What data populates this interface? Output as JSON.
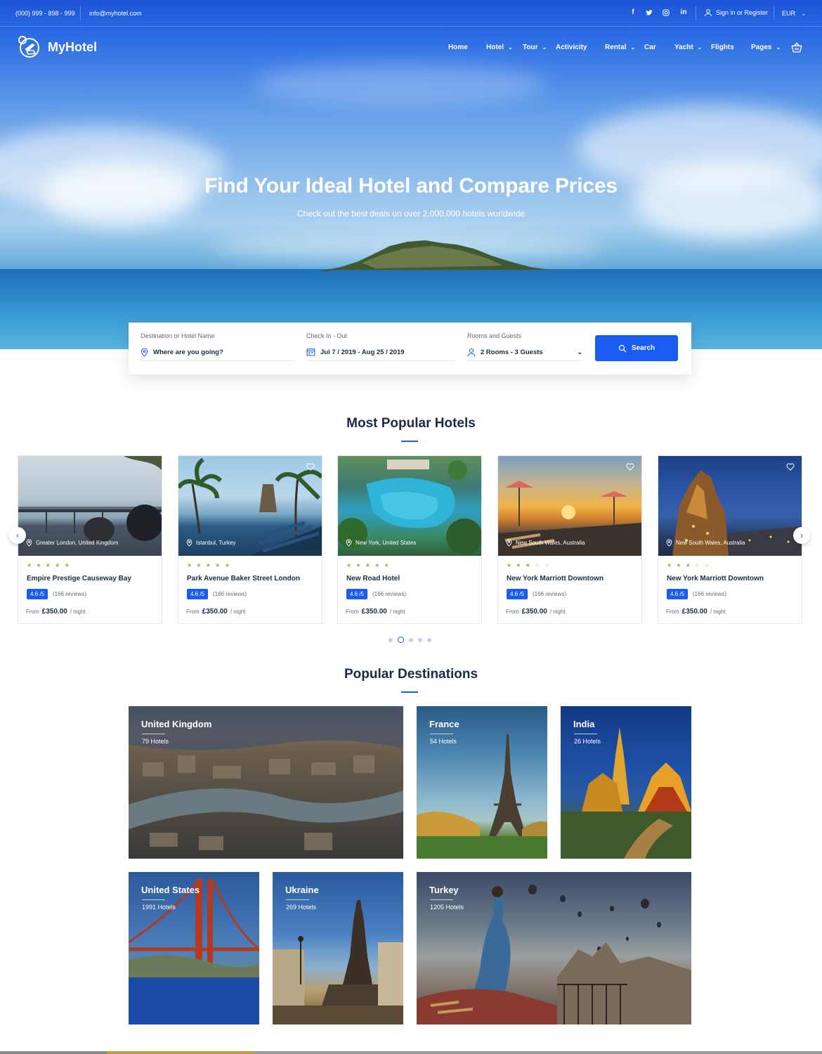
{
  "topbar": {
    "phone": "(000) 999 - 898 - 999",
    "email": "info@myhotel.com",
    "social": [
      {
        "icon": "facebook-icon",
        "glyph": "f"
      },
      {
        "icon": "twitter-icon",
        "glyph": "t"
      },
      {
        "icon": "instagram-icon",
        "glyph": "◎"
      },
      {
        "icon": "linkedin-icon",
        "glyph": "in"
      }
    ],
    "signin": "Sign in or Register",
    "currency": "EUR"
  },
  "brand": {
    "name": "MyHotel",
    "accent": "#1a5bf2"
  },
  "nav": {
    "items": [
      "Home",
      "Hotel",
      "Tour",
      "Activicity",
      "Rental",
      "Car",
      "Yacht",
      "Flights",
      "Pages"
    ]
  },
  "hero": {
    "title": "Find Your Ideal Hotel and Compare Prices",
    "subtitle": "Check out the best deals on over 2,000,000 hotels worldwide"
  },
  "search": {
    "destination_label": "Destination or Hotel Name",
    "destination_placeholder": "Where are you going?",
    "dates_label": "Check In - Out",
    "dates_value": "Jul 7 / 2019 - Aug 25 / 2019",
    "guests_label": "Rooms and Guests",
    "guests_value": "2 Rooms - 3 Guests",
    "button": "Search"
  },
  "popular_hotels": {
    "title": "Most Popular Hotels",
    "from_label": "From",
    "per_night": "/ night",
    "hotels": [
      {
        "location": "Greater London, United Kingdom",
        "name": "Empire Prestige Causeway Bay",
        "stars": "★ ★ ★ ★ ★",
        "rating": "4.6 /5",
        "reviews": "(166 reviews)",
        "price": "£350.00"
      },
      {
        "location": "Istanbul, Turkey",
        "name": "Park Avenue Baker Street London",
        "stars": "★ ★ ★ ★ ★",
        "rating": "4.6 /5",
        "reviews": "(166 reviews)",
        "price": "£350.00"
      },
      {
        "location": "New York, United States",
        "name": "New Road Hotel",
        "stars": "★ ★ ★ ★ ★",
        "rating": "4.6 /5",
        "reviews": "(166 reviews)",
        "price": "£350.00"
      },
      {
        "location": "New South Wales, Australia",
        "name": "New York Marriott Downtown",
        "stars": "★ ★ ★ ☆ ☆",
        "rating": "4.6 /5",
        "reviews": "(166 reviews)",
        "price": "£350.00"
      },
      {
        "location": "New South Wales, Australia",
        "name": "New York Marriott Downtown",
        "stars": "★ ★ ★ ☆ ☆",
        "rating": "4.6 /5",
        "reviews": "(166 reviews)",
        "price": "£350.00"
      }
    ]
  },
  "destinations": {
    "title": "Popular Destinations",
    "items": [
      {
        "name": "United Kingdom",
        "count": "79 Hotels"
      },
      {
        "name": "France",
        "count": "54 Hotels"
      },
      {
        "name": "India",
        "count": "26 Hotels"
      },
      {
        "name": "United States",
        "count": "1991 Hotels"
      },
      {
        "name": "Ukraine",
        "count": "269 Hotels"
      },
      {
        "name": "Turkey",
        "count": "1205 Hotels"
      }
    ]
  }
}
